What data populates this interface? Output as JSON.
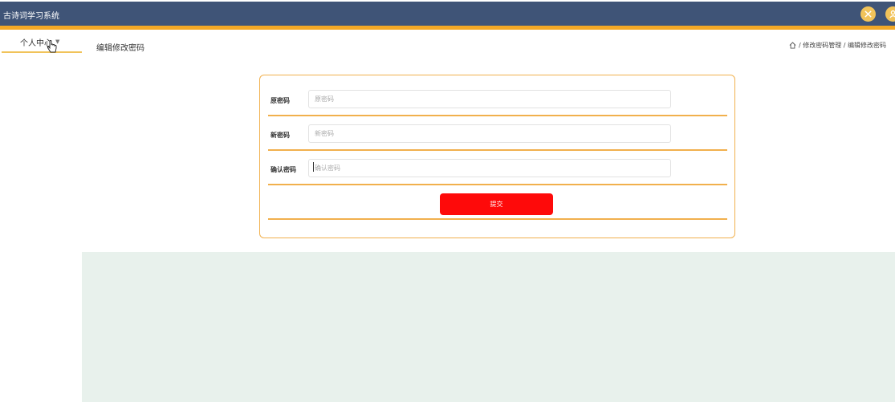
{
  "app": {
    "title": "古诗词学习系统"
  },
  "header": {
    "icons": [
      "fullscreen-icon",
      "user-icon"
    ],
    "accent_color": "#3f5477",
    "highlight_color": "#f3a826"
  },
  "sidebar": {
    "menu_label": "个人中心"
  },
  "page": {
    "title": "编辑修改密码"
  },
  "breadcrumb": {
    "text": "/ 修改密码管理 / 编辑修改密码"
  },
  "form": {
    "fields": [
      {
        "label": "原密码",
        "placeholder": "原密码",
        "value": ""
      },
      {
        "label": "新密码",
        "placeholder": "新密码",
        "value": ""
      },
      {
        "label": "确认密码",
        "placeholder": "确认密码",
        "value": ""
      }
    ],
    "submit_label": "提交",
    "submit_color": "#fe0a0a",
    "border_color": "#f1b04d"
  }
}
